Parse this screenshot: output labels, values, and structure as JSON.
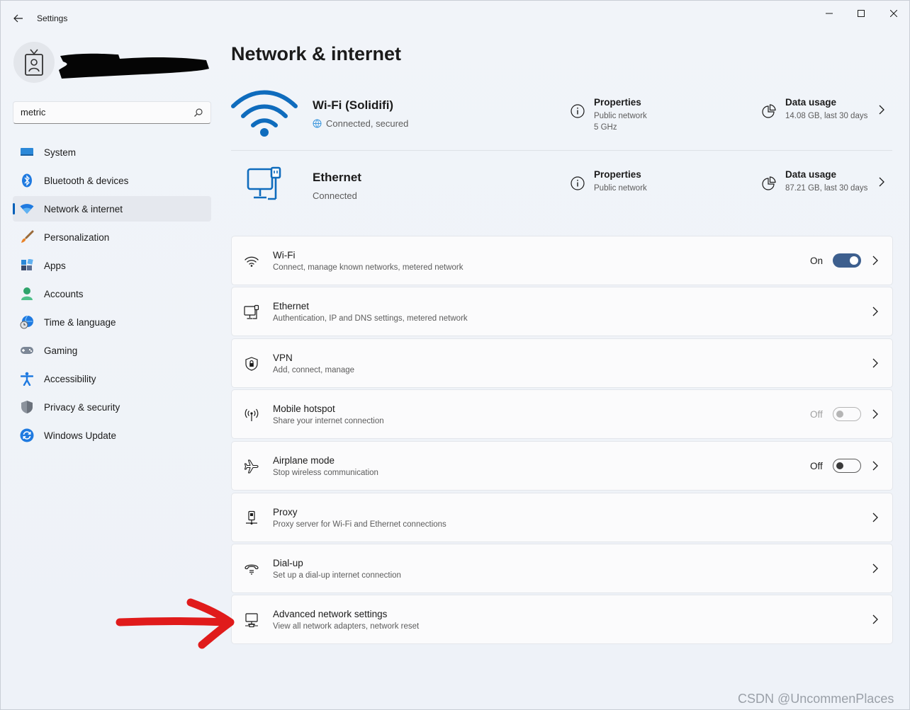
{
  "window": {
    "title": "Settings"
  },
  "search": {
    "value": "metric"
  },
  "nav": {
    "items": [
      {
        "label": "System",
        "icon": "system-icon"
      },
      {
        "label": "Bluetooth & devices",
        "icon": "bluetooth-icon"
      },
      {
        "label": "Network & internet",
        "icon": "wifi-icon",
        "active": true
      },
      {
        "label": "Personalization",
        "icon": "brush-icon"
      },
      {
        "label": "Apps",
        "icon": "apps-icon"
      },
      {
        "label": "Accounts",
        "icon": "person-icon"
      },
      {
        "label": "Time & language",
        "icon": "globe-clock-icon"
      },
      {
        "label": "Gaming",
        "icon": "gamepad-icon"
      },
      {
        "label": "Accessibility",
        "icon": "accessibility-icon"
      },
      {
        "label": "Privacy & security",
        "icon": "shield-icon"
      },
      {
        "label": "Windows Update",
        "icon": "update-icon"
      }
    ]
  },
  "main": {
    "title": "Network & internet",
    "wifi_conn": {
      "name": "Wi-Fi (Solidifi)",
      "status": "Connected, secured",
      "properties_title": "Properties",
      "properties_line1": "Public network",
      "properties_line2": "5 GHz",
      "usage_title": "Data usage",
      "usage_sub": "14.08 GB, last 30 days"
    },
    "eth_conn": {
      "name": "Ethernet",
      "status": "Connected",
      "properties_title": "Properties",
      "properties_line1": "Public network",
      "usage_title": "Data usage",
      "usage_sub": "87.21 GB, last 30 days"
    },
    "cards": [
      {
        "title": "Wi-Fi",
        "subtitle": "Connect, manage known networks, metered network",
        "icon": "wifi-icon",
        "toggle": "On"
      },
      {
        "title": "Ethernet",
        "subtitle": "Authentication, IP and DNS settings, metered network",
        "icon": "ethernet-icon"
      },
      {
        "title": "VPN",
        "subtitle": "Add, connect, manage",
        "icon": "vpn-shield-icon"
      },
      {
        "title": "Mobile hotspot",
        "subtitle": "Share your internet connection",
        "icon": "hotspot-icon",
        "toggle": "Off",
        "disabled": true
      },
      {
        "title": "Airplane mode",
        "subtitle": "Stop wireless communication",
        "icon": "airplane-icon",
        "toggle": "Off"
      },
      {
        "title": "Proxy",
        "subtitle": "Proxy server for Wi-Fi and Ethernet connections",
        "icon": "proxy-icon"
      },
      {
        "title": "Dial-up",
        "subtitle": "Set up a dial-up internet connection",
        "icon": "dialup-icon"
      },
      {
        "title": "Advanced network settings",
        "subtitle": "View all network adapters, network reset",
        "icon": "network-adapter-icon"
      }
    ]
  },
  "watermark": "CSDN @UncommenPlaces",
  "colors": {
    "accent": "#005fb8",
    "toggle_on": "#3d5f8e",
    "wifi_big": "#0f6cbd",
    "annotation_arrow": "#e01b1b"
  }
}
